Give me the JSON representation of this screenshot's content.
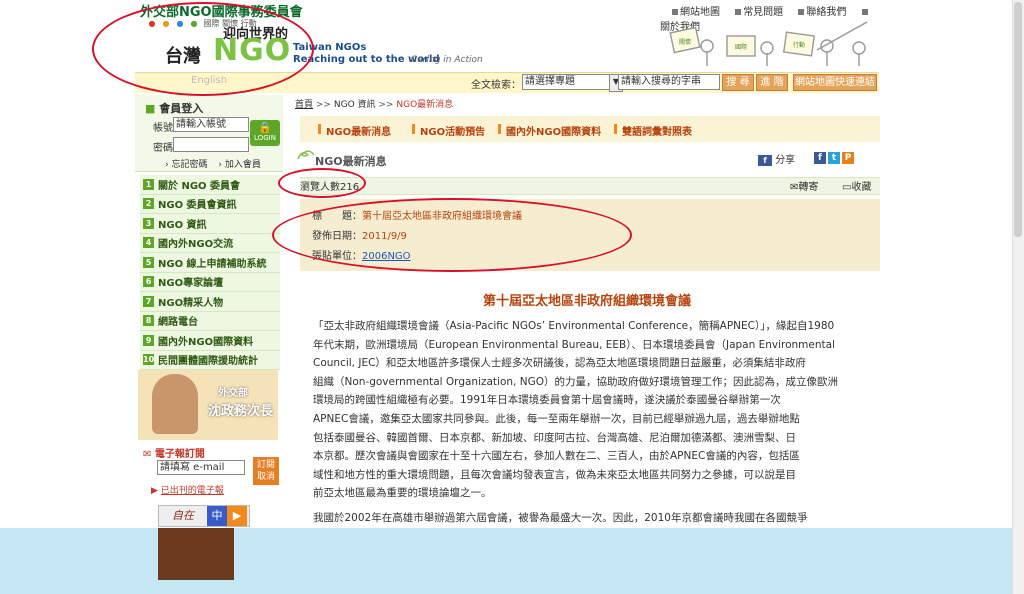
{
  "header": {
    "org_title": "外交部NGO國際事務委員會",
    "logo_sub": "國際 關懷 行動",
    "logo_world": "迎向世界的",
    "logo_taiwan": "台灣",
    "logo_ngo": "NGO",
    "logo_taiwan_ngos": "Taiwan NGOs",
    "logo_reach": "Reaching out to the world",
    "logo_caring": "Caring in Action",
    "english_link": "English"
  },
  "top_links": [
    "網站地圖",
    "常見問題",
    "聯絡我們",
    "關於我們"
  ],
  "search": {
    "label": "全文檢索：",
    "select_value": "請選擇專題",
    "input_value": "請輸入搜尋的字串",
    "search_btn": "搜 尋",
    "advanced_btn": "進 階",
    "map_btn": "網站地圖快速連結"
  },
  "member": {
    "title": "會員登入",
    "account_label": "帳號:",
    "account_value": "請輸入帳號",
    "password_label": "密碼:",
    "login_btn": "LOGIN",
    "forgot": "忘記密碼",
    "join": "加入會員"
  },
  "menu": [
    {
      "num": "1",
      "label": "關於 NGO 委員會"
    },
    {
      "num": "2",
      "label": "NGO 委員會資訊"
    },
    {
      "num": "3",
      "label": "NGO 資訊"
    },
    {
      "num": "4",
      "label": "國內外NGO交流"
    },
    {
      "num": "5",
      "label": "NGO 線上申請補助系統"
    },
    {
      "num": "6",
      "label": "NGO專家論壇"
    },
    {
      "num": "7",
      "label": "NGO精采人物"
    },
    {
      "num": "8",
      "label": "網路電台"
    },
    {
      "num": "9",
      "label": "國內外NGO國際資料"
    },
    {
      "num": "10",
      "label": "民間團體國際援助統計"
    }
  ],
  "banner": {
    "line1": "外交部",
    "line2": "沈政務次長"
  },
  "epaper": {
    "title": "電子報訂閱",
    "input_value": "請填寫 e-mail",
    "btn_line1": "訂閱",
    "btn_line2": "取消",
    "archive": "已出刊的電子報"
  },
  "lang": {
    "left": "自在",
    "mid": "中",
    "right": "▶"
  },
  "breadcrumb": {
    "home": "首頁",
    "sep1": ">>",
    "level2": "NGO 資訊",
    "sep2": ">>",
    "current": "NGO最新消息"
  },
  "subnav": [
    "NGO最新消息",
    "NGO活動預告",
    "國內外NGO國際資料",
    "雙語詞彙對照表"
  ],
  "section": {
    "title": "NGO最新消息",
    "share": "分享",
    "forward": "轉寄",
    "favorite": "收藏",
    "views": "瀏覽人數216"
  },
  "info": {
    "title_label": "標　　題：",
    "title_value": "第十屆亞太地區非政府組織環境會議",
    "date_label": "發佈日期：",
    "date_value": "2011/9/9",
    "unit_label": "張貼單位：",
    "unit_value": "2006NGO"
  },
  "article": {
    "title": "第十屆亞太地區非政府組織環境會議",
    "lines": [
      "「亞太非政府組織環境會議（Asia-Pacific NGOs’ Environmental Conference，簡稱APNEC）」，緣起自1980",
      "年代末期，歐洲環境局（European Environmental Bureau, EEB）、日本環境委員會（Japan Environmental",
      "Council, JEC）和亞太地區許多環保人士經多次研議後，認為亞太地區環境問題日益嚴重，必須集結非政府",
      "組織（Non-governmental Organization, NGO）的力量，協助政府做好環境管理工作；因此認為，成立像歐洲",
      "環境局的跨國性組織極有必要。1991年日本環境委員會第十屆會議時，遂決議於泰國曼谷舉辦第一次",
      "APNEC會議，邀集亞太國家共同參與。此後，每一至兩年舉辦一次，目前已經舉辦過九屆，過去舉辦地點",
      "包括泰國曼谷、韓國首爾、日本京都、新加坡、印度阿古拉、台灣高雄、尼泊爾加德滿都、澳洲雪梨、日",
      "本京都。歷次會議與會國家在十至十六國左右，參加人數在二、三百人，由於APNEC會議的內容，包括區",
      "域性和地方性的重大環境問題，且每次會議均發表宣言，做為未來亞太地區共同努力之參據，可以說是目",
      "前亞太地區最為重要的環境論壇之一。"
    ],
    "para2": "我國於2002年在高雄市舉辦過第六屆會議，被譽為最盛大一次。因此，2010年京都會議時我國在各國競爭"
  }
}
